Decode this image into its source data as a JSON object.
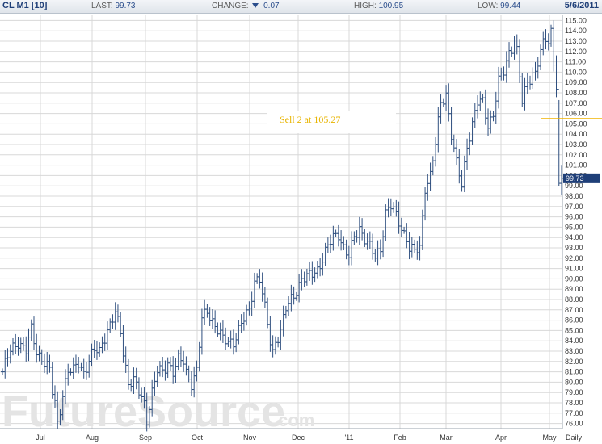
{
  "header": {
    "symbol": "CL M1 [10]",
    "last_label": "LAST:",
    "last_value": "99.73",
    "change_label": "CHANGE:",
    "change_direction_icon": "down-triangle-icon",
    "change_value": "0.07",
    "high_label": "HIGH:",
    "high_value": "100.95",
    "low_label": "LOW:",
    "low_value": "99.44",
    "date": "5/6/2011"
  },
  "watermark": {
    "main": "FutureSource",
    "suffix": ".com"
  },
  "annotation": {
    "text": "Sell 2 at 105.27",
    "level": 105.5,
    "color": "#f0b400"
  },
  "last_price_tag": {
    "text": "99.73",
    "value": 99.73
  },
  "colors": {
    "bars": "#2f4f7f",
    "grid": "#d8d8d8",
    "annotation_line": "#f0b400",
    "tag_bg": "#1f3f78"
  },
  "chart_data": {
    "type": "bar",
    "subtype": "ohlc",
    "ylim": [
      75.5,
      115.5
    ],
    "yticks": [
      76,
      77,
      78,
      79,
      80,
      81,
      82,
      83,
      84,
      85,
      86,
      87,
      88,
      89,
      90,
      91,
      92,
      93,
      94,
      95,
      96,
      97,
      98,
      99,
      100,
      101,
      102,
      103,
      104,
      105,
      106,
      107,
      108,
      109,
      110,
      111,
      112,
      113,
      114,
      115
    ],
    "ytick_labels": [
      "76.00",
      "77.00",
      "78.00",
      "79.00",
      "80.00",
      "81.00",
      "82.00",
      "83.00",
      "84.00",
      "85.00",
      "86.00",
      "87.00",
      "88.00",
      "89.00",
      "90.00",
      "91.00",
      "92.00",
      "93.00",
      "94.00",
      "95.00",
      "96.00",
      "97.00",
      "98.00",
      "99.00",
      "100.00",
      "101.00",
      "102.00",
      "103.00",
      "104.00",
      "105.00",
      "106.00",
      "107.00",
      "108.00",
      "109.00",
      "110.00",
      "111.00",
      "112.00",
      "113.00",
      "114.00",
      "115.00"
    ],
    "x_labels": [
      "Jul",
      "Aug",
      "Sep",
      "Oct",
      "Nov",
      "Dec",
      "'11",
      "Feb",
      "Mar",
      "Apr",
      "May"
    ],
    "x_right_label": "Daily",
    "grid": true,
    "series": [
      {
        "anchors": [
          [
            0,
            81
          ],
          [
            3,
            83
          ],
          [
            6,
            84
          ],
          [
            9,
            83
          ],
          [
            11,
            85
          ],
          [
            13,
            83
          ],
          [
            16,
            82
          ],
          [
            18,
            81
          ],
          [
            19,
            79
          ],
          [
            20,
            78
          ],
          [
            21,
            76
          ],
          [
            23,
            79
          ],
          [
            25,
            81
          ],
          [
            27,
            81
          ],
          [
            29,
            82
          ],
          [
            31,
            81
          ],
          [
            33,
            82
          ],
          [
            35,
            83
          ],
          [
            37,
            83
          ],
          [
            38,
            84
          ],
          [
            40,
            85
          ],
          [
            42,
            86
          ],
          [
            43,
            86.5
          ],
          [
            45,
            85
          ],
          [
            46,
            83
          ],
          [
            48,
            80
          ],
          [
            50,
            80
          ],
          [
            52,
            79
          ],
          [
            54,
            78
          ],
          [
            55,
            76.5
          ],
          [
            57,
            79
          ],
          [
            59,
            81
          ],
          [
            61,
            81
          ],
          [
            63,
            82
          ],
          [
            65,
            81
          ],
          [
            67,
            82
          ],
          [
            69,
            82
          ],
          [
            70,
            81
          ],
          [
            72,
            80
          ],
          [
            74,
            81
          ],
          [
            76,
            86
          ],
          [
            78,
            87
          ],
          [
            80,
            86
          ],
          [
            82,
            85
          ],
          [
            84,
            84
          ],
          [
            86,
            84
          ],
          [
            88,
            84
          ],
          [
            90,
            85
          ],
          [
            92,
            86
          ],
          [
            94,
            87
          ],
          [
            96,
            90
          ],
          [
            98,
            90
          ],
          [
            100,
            87
          ],
          [
            102,
            84
          ],
          [
            103,
            83
          ],
          [
            104,
            84
          ],
          [
            106,
            85
          ],
          [
            108,
            87
          ],
          [
            110,
            88
          ],
          [
            112,
            89
          ],
          [
            114,
            90
          ],
          [
            116,
            90
          ],
          [
            118,
            90.5
          ],
          [
            120,
            91
          ],
          [
            122,
            92
          ],
          [
            124,
            93
          ],
          [
            126,
            94
          ],
          [
            128,
            94.5
          ],
          [
            130,
            93
          ],
          [
            132,
            92
          ],
          [
            134,
            94
          ],
          [
            136,
            95
          ],
          [
            138,
            94
          ],
          [
            140,
            93
          ],
          [
            142,
            92
          ],
          [
            144,
            93
          ],
          [
            146,
            96.5
          ],
          [
            148,
            97
          ],
          [
            150,
            96
          ],
          [
            152,
            95
          ],
          [
            154,
            94
          ],
          [
            155,
            93
          ],
          [
            157,
            92.5
          ],
          [
            159,
            93
          ],
          [
            160,
            96
          ],
          [
            161,
            99
          ],
          [
            163,
            100
          ],
          [
            165,
            103
          ],
          [
            167,
            107
          ],
          [
            169,
            108
          ],
          [
            171,
            104
          ],
          [
            173,
            101
          ],
          [
            175,
            99
          ],
          [
            177,
            103
          ],
          [
            179,
            105
          ],
          [
            181,
            107
          ],
          [
            183,
            107
          ],
          [
            185,
            105
          ],
          [
            187,
            106
          ],
          [
            189,
            109
          ],
          [
            191,
            110
          ],
          [
            193,
            112
          ],
          [
            195,
            113
          ],
          [
            196,
            112
          ],
          [
            198,
            107
          ],
          [
            200,
            109
          ],
          [
            202,
            110
          ],
          [
            203,
            110
          ],
          [
            205,
            112
          ],
          [
            207,
            113
          ],
          [
            208,
            113
          ],
          [
            209,
            114
          ],
          [
            210,
            111
          ],
          [
            211,
            109
          ],
          [
            212,
            99
          ],
          [
            213,
            99.73
          ]
        ]
      }
    ]
  }
}
